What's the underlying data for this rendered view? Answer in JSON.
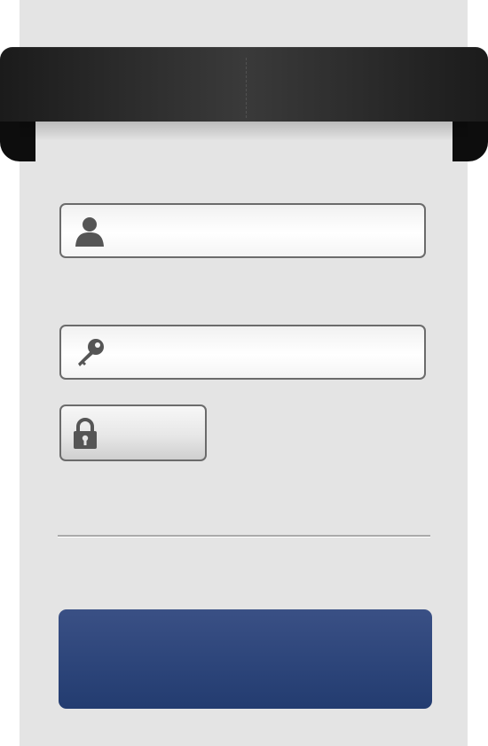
{
  "form": {
    "username": {
      "value": "",
      "placeholder": "",
      "icon": "user-icon"
    },
    "password": {
      "value": "",
      "placeholder": "",
      "icon": "key-icon"
    },
    "lock_button": {
      "label": "",
      "icon": "lock-icon"
    },
    "submit_button": {
      "label": ""
    }
  },
  "colors": {
    "panel": "#e4e4e4",
    "ribbon": "#2b2b2b",
    "field_border": "#6b6b6b",
    "icon": "#555555",
    "submit": "#2e467b"
  }
}
